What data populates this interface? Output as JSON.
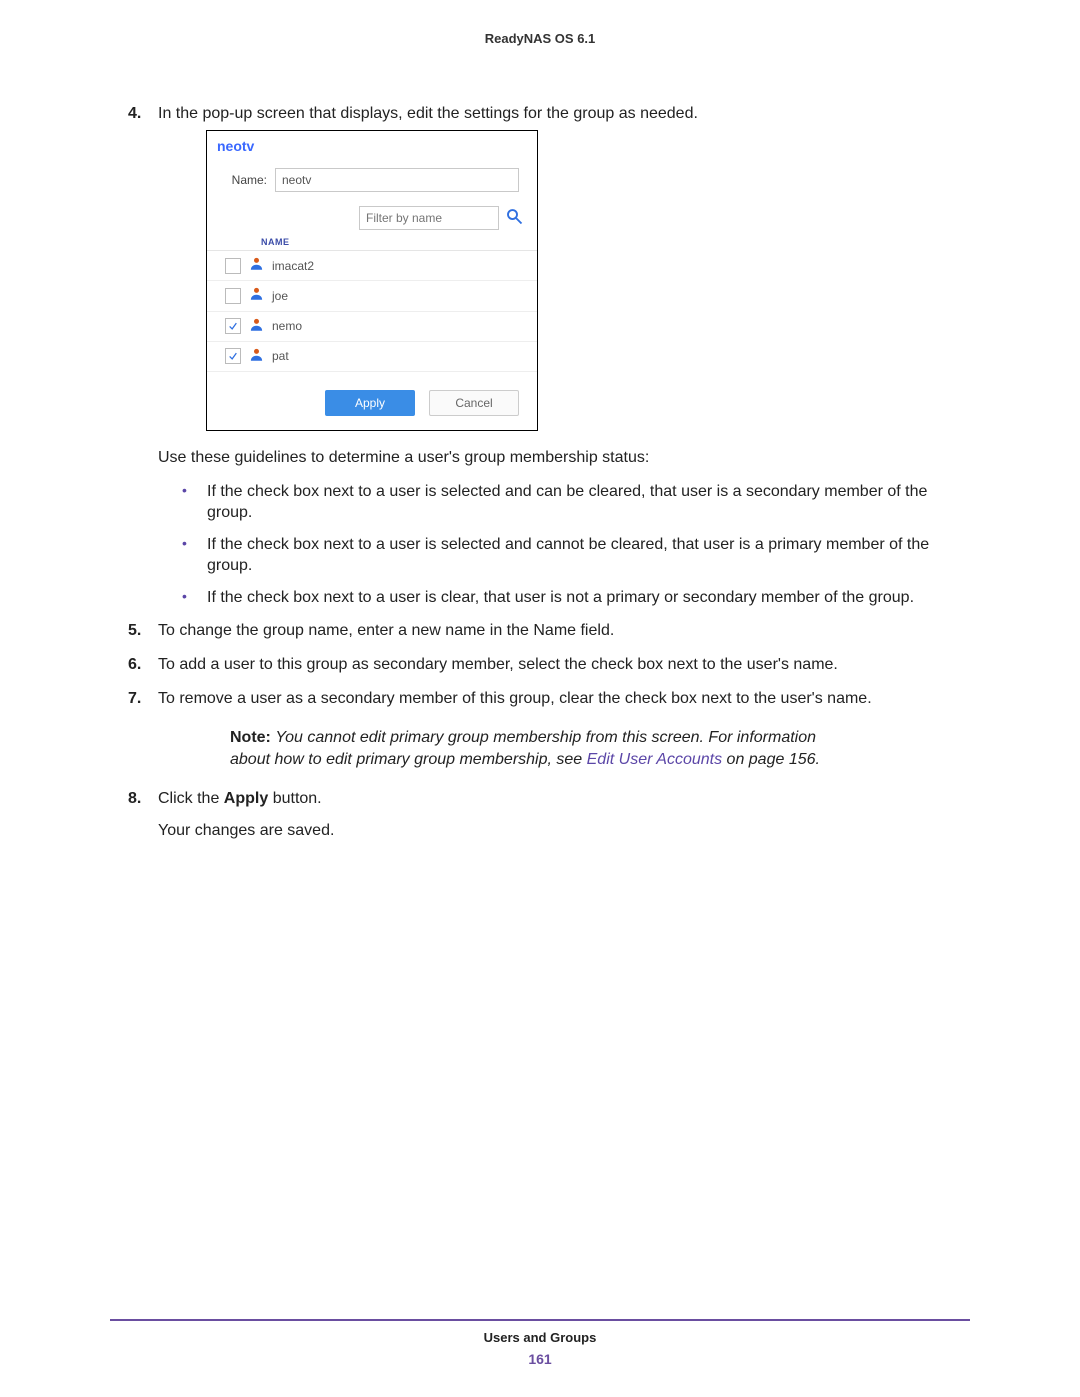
{
  "header": {
    "title": "ReadyNAS OS 6.1"
  },
  "steps": {
    "s4": {
      "num": "4.",
      "text": "In the pop-up screen that displays, edit the settings for the group as needed."
    },
    "guidelines_lead": "Use these guidelines to determine a user's group membership status:",
    "bullets": [
      "If the check box next to a user is selected and can be cleared, that user is a secondary member of the group.",
      "If the check box next to a user is selected and cannot be cleared, that user is a primary member of the group.",
      "If the check box next to a user is clear, that user is not a primary or secondary member of the group."
    ],
    "s5": {
      "num": "5.",
      "text": "To change the group name, enter a new name in the Name field."
    },
    "s6": {
      "num": "6.",
      "text": "To add a user to this group as secondary member, select the check box next to the user's name."
    },
    "s7": {
      "num": "7.",
      "text": "To remove a user as a secondary member of this group, clear the check box next to the user's name."
    },
    "note": {
      "label": "Note:",
      "body_a": "You cannot edit primary group membership from this screen. For information about how to edit primary group membership, see ",
      "link": "Edit User Accounts",
      "body_b": " on page 156."
    },
    "s8": {
      "num": "8.",
      "text_a": "Click the ",
      "bold": "Apply",
      "text_b": " button."
    },
    "after8": "Your changes are saved."
  },
  "dialog": {
    "title": "neotv",
    "name_label": "Name:",
    "name_value": "neotv",
    "filter_placeholder": "Filter by name",
    "column_header": "NAME",
    "users": [
      {
        "name": "imacat2",
        "checked": false
      },
      {
        "name": "joe",
        "checked": false
      },
      {
        "name": "nemo",
        "checked": true
      },
      {
        "name": "pat",
        "checked": true
      }
    ],
    "apply": "Apply",
    "cancel": "Cancel"
  },
  "footer": {
    "section": "Users and Groups",
    "page": "161"
  }
}
